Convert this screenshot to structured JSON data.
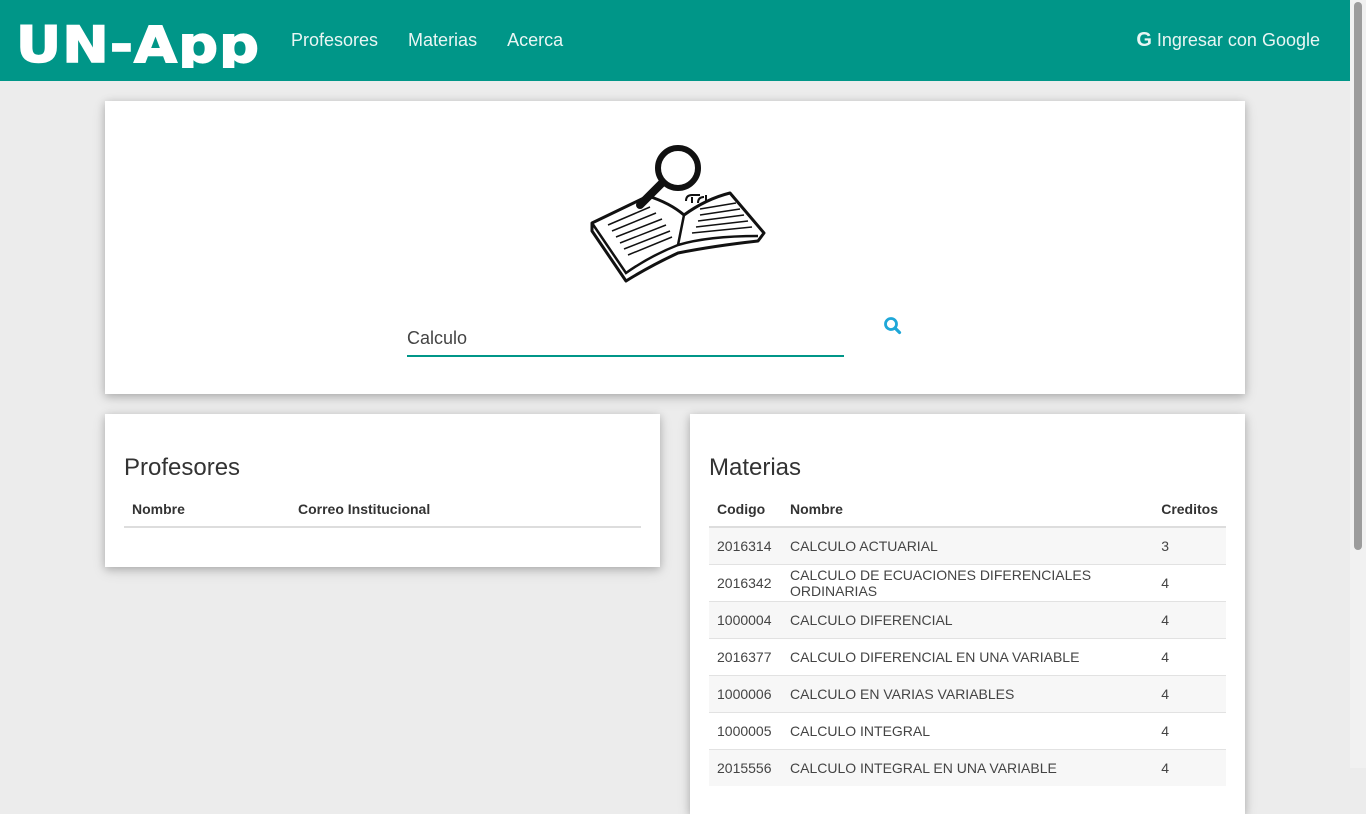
{
  "app": {
    "logo_text": "UN-App"
  },
  "navbar": {
    "links": [
      "Profesores",
      "Materias",
      "Acerca"
    ],
    "login_label": "Ingresar con Google",
    "login_icon": "G"
  },
  "search": {
    "value": "Calculo",
    "icon": "search-icon"
  },
  "profesores": {
    "title": "Profesores",
    "columns": [
      "Nombre",
      "Correo Institucional"
    ],
    "rows": []
  },
  "materias": {
    "title": "Materias",
    "columns": [
      "Codigo",
      "Nombre",
      "Creditos"
    ],
    "rows": [
      [
        "2016314",
        "CALCULO ACTUARIAL",
        "3"
      ],
      [
        "2016342",
        "CALCULO DE ECUACIONES DIFERENCIALES ORDINARIAS",
        "4"
      ],
      [
        "1000004",
        "CALCULO DIFERENCIAL",
        "4"
      ],
      [
        "2016377",
        "CALCULO DIFERENCIAL EN UNA VARIABLE",
        "4"
      ],
      [
        "1000006",
        "CALCULO EN VARIAS VARIABLES",
        "4"
      ],
      [
        "1000005",
        "CALCULO INTEGRAL",
        "4"
      ],
      [
        "2015556",
        "CALCULO INTEGRAL EN UNA VARIABLE",
        "4"
      ]
    ]
  },
  "colors": {
    "primary": "#009688",
    "background": "#ececec",
    "search_icon": "#1ea7d8"
  }
}
